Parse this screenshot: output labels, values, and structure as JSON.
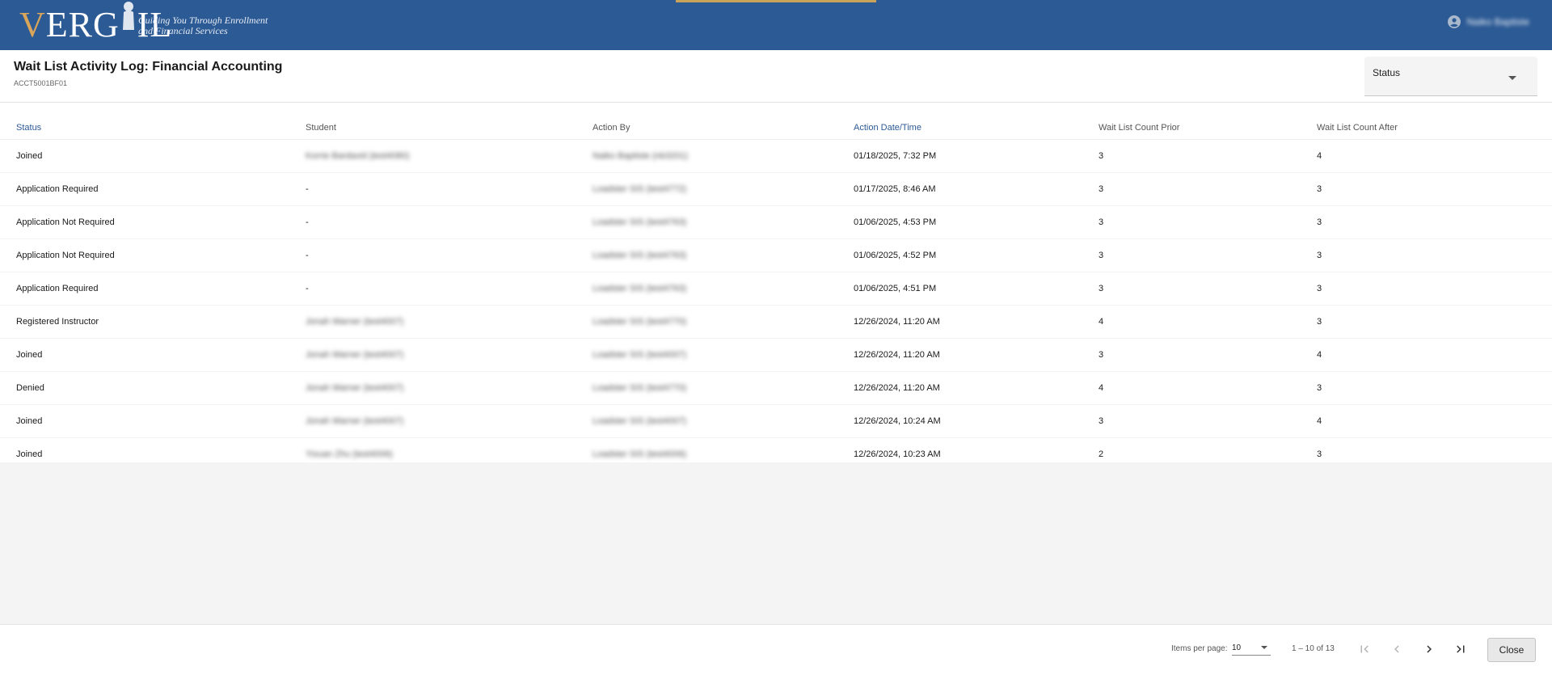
{
  "header": {
    "logo_text": "VERGIL",
    "tagline_line1": "Guiding You Through Enrollment",
    "tagline_line2": "and Financial Services",
    "user_name": "Naiko Baptiste"
  },
  "page": {
    "title": "Wait List Activity Log: Financial Accounting",
    "subtitle": "ACCT5001BF01"
  },
  "filter": {
    "label": "Status"
  },
  "table": {
    "columns": [
      "Status",
      "Student",
      "Action By",
      "Action Date/Time",
      "Wait List Count Prior",
      "Wait List Count After"
    ],
    "rows": [
      {
        "status": "Joined",
        "student": "Korrie Bardavid (test4080)",
        "action_by": "Naiko Baptiste (nb3201)",
        "datetime": "01/18/2025, 7:32 PM",
        "prior": "3",
        "after": "4"
      },
      {
        "status": "Application Required",
        "student": "-",
        "action_by": "Loadster SIS (test4772)",
        "datetime": "01/17/2025, 8:46 AM",
        "prior": "3",
        "after": "3"
      },
      {
        "status": "Application Not Required",
        "student": "-",
        "action_by": "Loadster SIS (test4763)",
        "datetime": "01/06/2025, 4:53 PM",
        "prior": "3",
        "after": "3"
      },
      {
        "status": "Application Not Required",
        "student": "-",
        "action_by": "Loadster SIS (test4763)",
        "datetime": "01/06/2025, 4:52 PM",
        "prior": "3",
        "after": "3"
      },
      {
        "status": "Application Required",
        "student": "-",
        "action_by": "Loadster SIS (test4763)",
        "datetime": "01/06/2025, 4:51 PM",
        "prior": "3",
        "after": "3"
      },
      {
        "status": "Registered Instructor",
        "student": "Jonah Warner (test4007)",
        "action_by": "Loadster SIS (test4770)",
        "datetime": "12/26/2024, 11:20 AM",
        "prior": "4",
        "after": "3"
      },
      {
        "status": "Joined",
        "student": "Jonah Warner (test4007)",
        "action_by": "Loadster SIS (test4007)",
        "datetime": "12/26/2024, 11:20 AM",
        "prior": "3",
        "after": "4"
      },
      {
        "status": "Denied",
        "student": "Jonah Warner (test4007)",
        "action_by": "Loadster SIS (test4770)",
        "datetime": "12/26/2024, 11:20 AM",
        "prior": "4",
        "after": "3"
      },
      {
        "status": "Joined",
        "student": "Jonah Warner (test4007)",
        "action_by": "Loadster SIS (test4007)",
        "datetime": "12/26/2024, 10:24 AM",
        "prior": "3",
        "after": "4"
      },
      {
        "status": "Joined",
        "student": "Yixuan Zhu (test4006)",
        "action_by": "Loadster SIS (test4006)",
        "datetime": "12/26/2024, 10:23 AM",
        "prior": "2",
        "after": "3"
      }
    ]
  },
  "paginator": {
    "items_per_page_label": "Items per page:",
    "items_per_page": "10",
    "range_label": "1 – 10 of 13",
    "first_icon": "first-page-icon",
    "prev_icon": "chevron-left-icon",
    "next_icon": "chevron-right-icon",
    "last_icon": "last-page-icon"
  },
  "actions": {
    "close_label": "Close"
  },
  "colors": {
    "header_bg": "#2c5a94",
    "accent": "#c8a45a",
    "link": "#2c5a94"
  }
}
